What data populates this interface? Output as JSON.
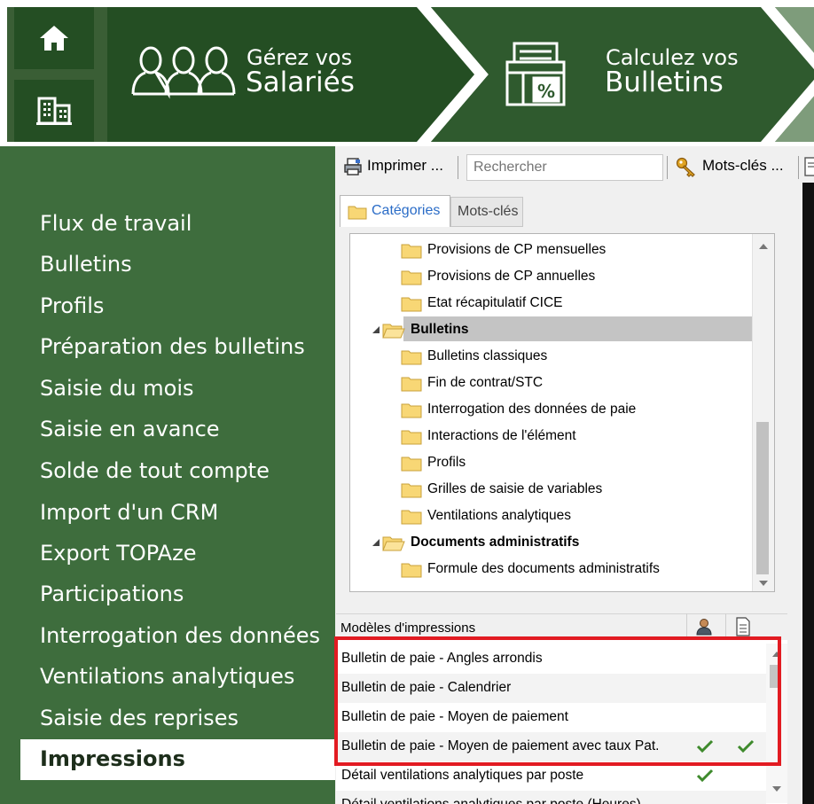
{
  "banner": {
    "home_icon": "home-icon",
    "company_icon": "building-icon",
    "step1": {
      "small": "Gérez vos",
      "big": "Salariés",
      "icon": "users-icon"
    },
    "step2": {
      "small": "Calculez vos",
      "big": "Bulletins",
      "icon": "calculator-document-icon"
    }
  },
  "nav": {
    "items": [
      "Flux de travail",
      "Bulletins",
      "Profils",
      "Préparation des bulletins",
      "Saisie du mois",
      "Saisie en avance",
      "Solde de tout compte",
      "Import d'un CRM",
      "Export TOPAze",
      "Participations",
      "Interrogation des données",
      "Ventilations analytiques",
      "Saisie des reprises",
      "Impressions"
    ],
    "selected_index": 13
  },
  "toolbar": {
    "print_label": "Imprimer ...",
    "search_placeholder": "Rechercher",
    "keywords_label": "Mots-clés ...",
    "print_icon": "printer-icon",
    "keywords_icon": "key-icon"
  },
  "tabs": {
    "categories": "Catégories",
    "keywords": "Mots-clés",
    "active": "categories"
  },
  "tree": {
    "rows": [
      {
        "label": "Provisions de CP mensuelles",
        "level": 2
      },
      {
        "label": "Provisions de CP annuelles",
        "level": 2
      },
      {
        "label": "Etat récapitulatif CICE",
        "level": 2
      },
      {
        "label": "Bulletins",
        "level": 1,
        "expanded": true,
        "selected": true
      },
      {
        "label": "Bulletins classiques",
        "level": 2
      },
      {
        "label": "Fin de contrat/STC",
        "level": 2
      },
      {
        "label": "Interrogation des données de paie",
        "level": 2
      },
      {
        "label": "Interactions de l'élément",
        "level": 2
      },
      {
        "label": "Profils",
        "level": 2
      },
      {
        "label": "Grilles de saisie de variables",
        "level": 2
      },
      {
        "label": "Ventilations analytiques",
        "level": 2
      },
      {
        "label": "Documents administratifs",
        "level": 1,
        "expanded": true
      },
      {
        "label": "Formule des documents administratifs",
        "level": 2
      }
    ]
  },
  "models": {
    "title": "Modèles d'impressions",
    "rows": [
      {
        "label": "Bulletin de paie - Angles arrondis",
        "check1": false,
        "check2": false
      },
      {
        "label": "Bulletin de paie - Calendrier",
        "check1": false,
        "check2": false
      },
      {
        "label": "Bulletin de paie - Moyen de paiement",
        "check1": false,
        "check2": false
      },
      {
        "label": "Bulletin de paie - Moyen de paiement avec taux Pat.",
        "check1": true,
        "check2": true
      },
      {
        "label": "Détail ventilations analytiques par poste",
        "check1": true,
        "check2": false
      },
      {
        "label": "Détail ventilations analytiques par poste (Heures)",
        "check1": false,
        "check2": false
      }
    ],
    "highlight_rows": [
      0,
      1,
      2,
      3
    ]
  },
  "colors": {
    "banner_green": "#3a5e35",
    "nav_green": "#3e6d3d",
    "highlight_red": "#e21b22",
    "check_green": "#3e8a2c",
    "tab_blue": "#2a6cc7"
  }
}
